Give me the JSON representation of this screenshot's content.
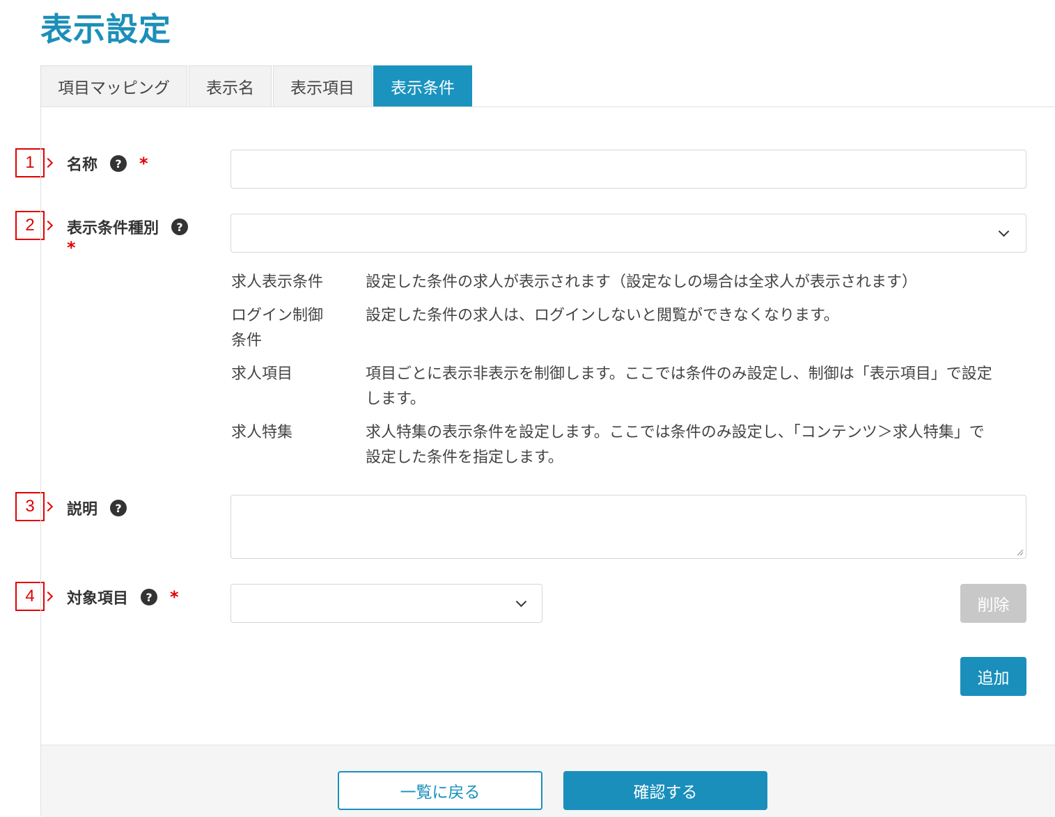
{
  "page": {
    "title": "表示設定"
  },
  "tabs": [
    {
      "label": "項目マッピング",
      "active": false
    },
    {
      "label": "表示名",
      "active": false
    },
    {
      "label": "表示項目",
      "active": false
    },
    {
      "label": "表示条件",
      "active": true
    }
  ],
  "markers": [
    "1",
    "2",
    "3",
    "4"
  ],
  "form": {
    "name": {
      "label": "名称",
      "value": "",
      "placeholder": ""
    },
    "condition_type": {
      "label": "表示条件種別",
      "selected": "",
      "descriptions": [
        {
          "term": "求人表示条件",
          "text": "設定した条件の求人が表示されます（設定なしの場合は全求人が表示されます）"
        },
        {
          "term": "ログイン制御条件",
          "text": "設定した条件の求人は、ログインしないと閲覧ができなくなります。"
        },
        {
          "term": "求人項目",
          "text": "項目ごとに表示非表示を制御します。ここでは条件のみ設定し、制御は「表示項目」で設定します。"
        },
        {
          "term": "求人特集",
          "text": "求人特集の表示条件を設定します。ここでは条件のみ設定し、「コンテンツ＞求人特集」で設定した条件を指定します。"
        }
      ]
    },
    "description": {
      "label": "説明",
      "value": ""
    },
    "target_item": {
      "label": "対象項目",
      "selected": ""
    },
    "help_symbol": "?",
    "required_symbol": "*"
  },
  "buttons": {
    "delete": "削除",
    "add": "追加",
    "back": "一覧に戻る",
    "confirm": "確認する"
  },
  "colors": {
    "accent": "#1a8fbb",
    "title": "#1b8fb8",
    "required": "#e00000",
    "disabled": "#c8c8c8"
  }
}
